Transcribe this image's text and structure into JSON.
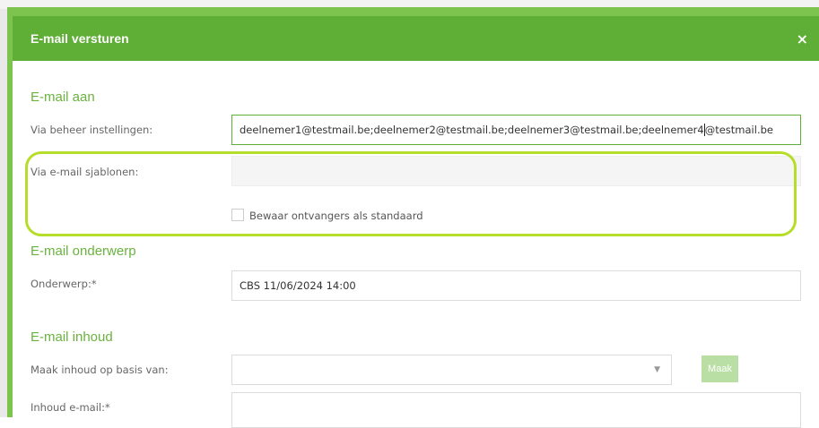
{
  "dialog": {
    "title": "E-mail versturen",
    "close_glyph": "×"
  },
  "section_to": {
    "title": "E-mail aan",
    "via_settings_label": "Via beheer instellingen:",
    "via_settings_value_before_caret": "deelnemer1@testmail.be;deelnemer2@testmail.be;deelnemer3@testmail.be;deelnemer4",
    "via_settings_value_after_caret": "@testmail.be",
    "via_templates_label": "Via e-mail sjablonen:",
    "via_templates_value": "",
    "save_default_label": "Bewaar ontvangers als standaard",
    "save_default_checked": false
  },
  "section_subject": {
    "title": "E-mail onderwerp",
    "subject_label": "Onderwerp:*",
    "subject_value": "CBS 11/06/2024 14:00"
  },
  "section_content": {
    "title": "E-mail inhoud",
    "base_label": "Maak inhoud op basis van:",
    "base_value": "",
    "make_button_label": "Maak",
    "content_label": "Inhoud e-mail:*"
  },
  "colors": {
    "header": "#5fae36",
    "accent_text": "#6ab23e",
    "highlight": "#b6dd2a",
    "button_disabled": "#b9dfa5"
  },
  "icons": {
    "close": "close-icon",
    "dropdown": "chevron-down-icon"
  }
}
